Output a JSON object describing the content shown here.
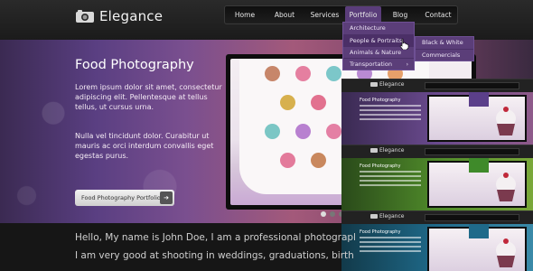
{
  "brand": {
    "name": "Elegance"
  },
  "nav": {
    "items": [
      {
        "label": "Home",
        "name": "nav-home"
      },
      {
        "label": "About",
        "name": "nav-about"
      },
      {
        "label": "Services",
        "name": "nav-services"
      },
      {
        "label": "Portfolio",
        "name": "nav-portfolio",
        "active": true
      },
      {
        "label": "Blog",
        "name": "nav-blog"
      },
      {
        "label": "Contact",
        "name": "nav-contact"
      }
    ]
  },
  "dropdown": {
    "items": [
      "Architecture",
      "People & Portraits",
      "Animals & Nature",
      "Transportation"
    ],
    "submenu": [
      "Black & White",
      "Commercials"
    ],
    "arrow_glyph": "›"
  },
  "hero": {
    "title": "Food Photography",
    "para1": "Lorem ipsum dolor sit amet, consectetur adipiscing elit. Pellentesque at tellus tellus, ut cursus urna.",
    "para2": "Nulla vel tincidunt dolor. Curabitur ut mauris ac orci interdum convallis eget egestas purus.",
    "button_label": "Food Photography Portfolio",
    "button_arrow": "➔"
  },
  "intro": {
    "line1": "Hello, My name is John Doe, I am a professional photographer b",
    "line2": "I am very good at shooting in weddings, graduations, birth day"
  },
  "previews": {
    "logo": "Elegance",
    "title": "Food Photography",
    "color_variants": [
      "#5b3f8a",
      "#3f8a2a",
      "#1f6a8a"
    ]
  },
  "colors": {
    "accent_purple": "#5b3e79",
    "header_bg": "#1b1b1b"
  }
}
